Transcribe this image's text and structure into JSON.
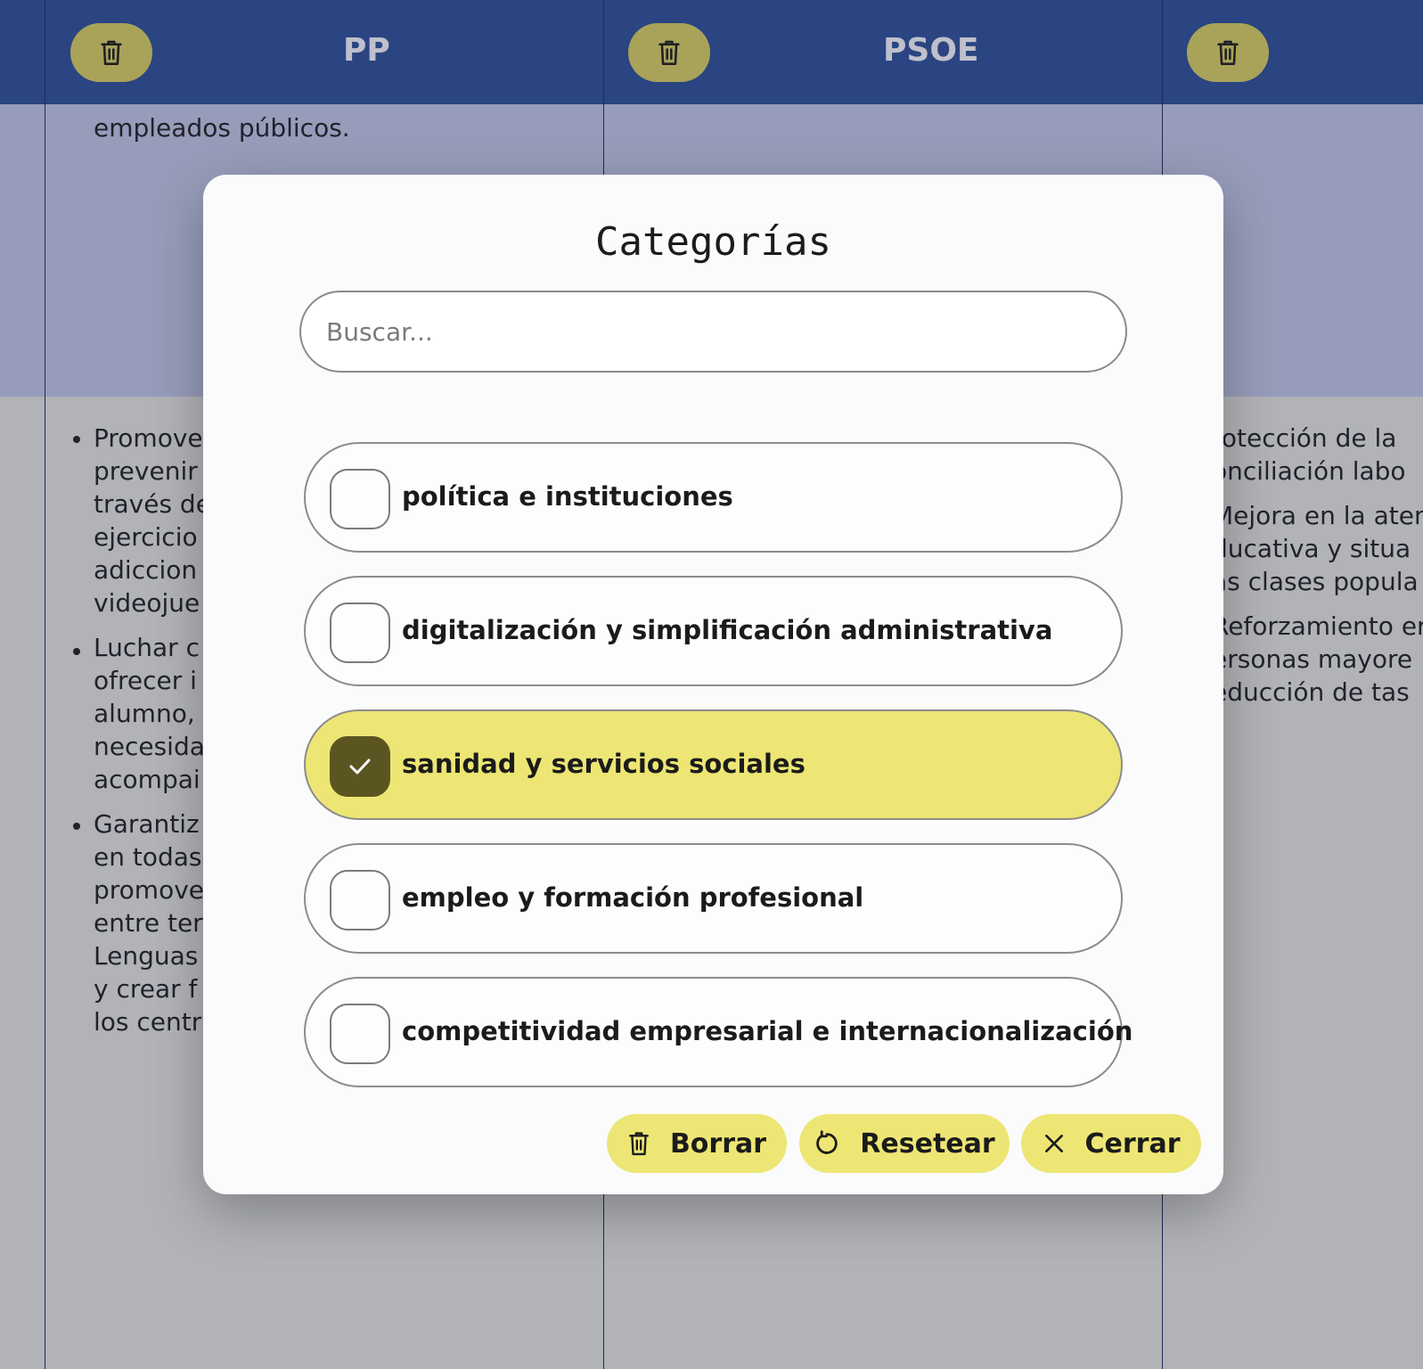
{
  "header": {
    "parties": [
      {
        "name": "PP",
        "delete_icon": "trash-icon"
      },
      {
        "name": "PSOE",
        "delete_icon": "trash-icon"
      },
      {
        "name": "",
        "delete_icon": "trash-icon"
      }
    ]
  },
  "background": {
    "left_column_top_text": "empleados públicos.",
    "left_column_lines": [
      "Promove",
      "prevenir",
      "través de",
      "ejercicio",
      "adiccion",
      "videojue",
      "Luchar c",
      "ofrecer i",
      "alumno,",
      "necesida",
      "acompai",
      "Garantiz",
      "en todas",
      "promove",
      "entre ter",
      "Lenguas",
      "y crear f",
      "los centr"
    ],
    "right_column_lines": [
      "rotección de la",
      "onciliación labo",
      "Mejora en la aten",
      "ducativa y situa",
      "as clases popula",
      "Reforzamiento er",
      "ersonas mayore",
      "educción de tas"
    ]
  },
  "modal": {
    "title": "Categorías",
    "search_placeholder": "Buscar...",
    "categories": [
      {
        "label": "política e instituciones",
        "checked": false
      },
      {
        "label": "digitalización y simplificación administrativa",
        "checked": false
      },
      {
        "label": "sanidad y servicios sociales",
        "checked": true
      },
      {
        "label": "empleo y formación profesional",
        "checked": false
      },
      {
        "label": "competitividad empresarial e internacionalización",
        "checked": false
      }
    ],
    "actions": {
      "delete": {
        "label": "Borrar",
        "icon": "trash-icon"
      },
      "reset": {
        "label": "Resetear",
        "icon": "refresh-icon"
      },
      "close": {
        "label": "Cerrar",
        "icon": "close-icon"
      }
    }
  },
  "colors": {
    "header_bg": "#2b4c93",
    "accent_yellow": "#ede674",
    "checkbox_checked": "#5b5621"
  }
}
